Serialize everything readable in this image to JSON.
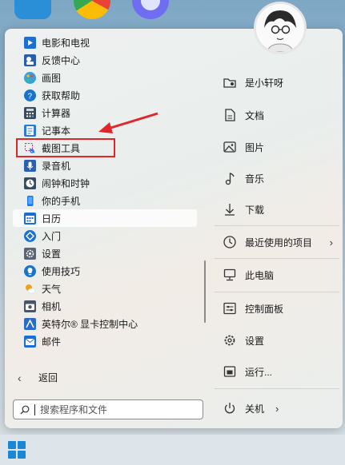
{
  "start_menu": {
    "apps": [
      {
        "label": "电影和电视",
        "icon": "movies-tv-icon",
        "color": "#1f6fd1"
      },
      {
        "label": "反馈中心",
        "icon": "feedback-hub-icon",
        "color": "#2a5ea8"
      },
      {
        "label": "画图",
        "icon": "paint-icon",
        "color": "#3aa0d8"
      },
      {
        "label": "获取帮助",
        "icon": "get-help-icon",
        "color": "#1a73c9"
      },
      {
        "label": "计算器",
        "icon": "calculator-icon",
        "color": "#3b4a5a"
      },
      {
        "label": "记事本",
        "icon": "notepad-icon",
        "color": "#2b7ad6"
      },
      {
        "label": "截图工具",
        "icon": "snipping-tool-icon",
        "color": "#e0267a"
      },
      {
        "label": "录音机",
        "icon": "voice-recorder-icon",
        "color": "#2b5fb0"
      },
      {
        "label": "闹钟和时钟",
        "icon": "alarms-clock-icon",
        "color": "#3a4a5c"
      },
      {
        "label": "你的手机",
        "icon": "your-phone-icon",
        "color": "#1a73e8"
      },
      {
        "label": "日历",
        "icon": "calendar-icon",
        "color": "#1a6ed8"
      },
      {
        "label": "入门",
        "icon": "get-started-icon",
        "color": "#1e6fd0"
      },
      {
        "label": "设置",
        "icon": "settings-icon",
        "color": "#5a6472"
      },
      {
        "label": "使用技巧",
        "icon": "tips-icon",
        "color": "#1a73c9"
      },
      {
        "label": "天气",
        "icon": "weather-icon",
        "color": "#f0a019"
      },
      {
        "label": "相机",
        "icon": "camera-icon",
        "color": "#4a5566"
      },
      {
        "label": "英特尔® 显卡控制中心",
        "icon": "intel-graphics-icon",
        "color": "#2b6ac7"
      },
      {
        "label": "邮件",
        "icon": "mail-icon",
        "color": "#1a6ed8"
      }
    ],
    "selected_index": 10,
    "back_label": "返回",
    "search_placeholder": "搜索程序和文件",
    "right": {
      "items": [
        {
          "label": "是小轩呀",
          "icon": "user-folder-icon"
        },
        {
          "label": "文档",
          "icon": "document-icon"
        },
        {
          "label": "图片",
          "icon": "pictures-icon"
        },
        {
          "label": "音乐",
          "icon": "music-icon"
        },
        {
          "label": "下载",
          "icon": "download-icon"
        },
        {
          "label": "最近使用的项目",
          "icon": "recent-items-icon",
          "has_arrow": true
        },
        {
          "label": "此电脑",
          "icon": "this-pc-icon"
        },
        {
          "label": "控制面板",
          "icon": "control-panel-icon"
        },
        {
          "label": "设置",
          "icon": "settings-gear-icon"
        },
        {
          "label": "运行...",
          "icon": "run-icon"
        }
      ],
      "power_label": "关机"
    }
  },
  "annotation": {
    "color": "#e0262b",
    "target": "截图工具"
  }
}
